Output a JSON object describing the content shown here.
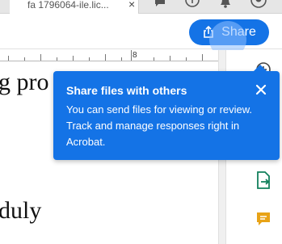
{
  "tab": {
    "title": "fa 1796064-ile.lic...",
    "close_glyph": "×"
  },
  "tabstrip_icons": [
    "chat-icon",
    "help-icon",
    "bell-icon",
    "profile-icon"
  ],
  "toolbar": {
    "share_label": "Share"
  },
  "ruler": {
    "marker": "8"
  },
  "document": {
    "line1": "g pro",
    "line2": "duly"
  },
  "popover": {
    "title": "Share files with others",
    "body": "You can send files for viewing or review. Track and manage responses right in Acrobat."
  },
  "right_pane": {
    "icons": [
      "add-comment-icon",
      "export-pdf-icon",
      "comment-icon"
    ]
  },
  "colors": {
    "accent": "#1473e6",
    "highlight": "#8cbeff",
    "export_icon": "#12805c",
    "comment_icon": "#e8a317"
  }
}
